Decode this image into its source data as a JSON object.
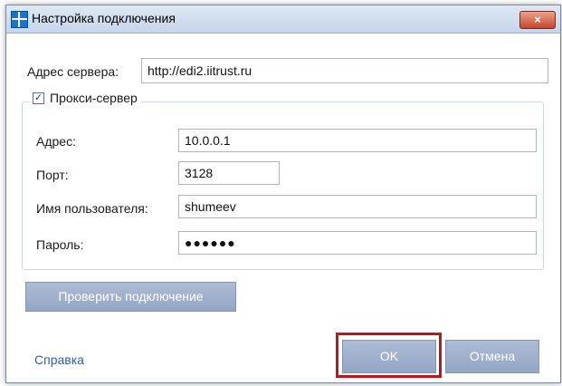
{
  "window": {
    "title": "Настройка подключения",
    "close_label": "×"
  },
  "server": {
    "label": "Адрес сервера:",
    "value": "http://edi2.iitrust.ru"
  },
  "proxy": {
    "checkbox_label": "Прокси-сервер",
    "checked": true,
    "address_label": "Адрес:",
    "address_value": "10.0.0.1",
    "port_label": "Порт:",
    "port_value": "3128",
    "username_label": "Имя пользователя:",
    "username_value": "shumeev",
    "password_label": "Пароль:",
    "password_value": "●●●●●●"
  },
  "actions": {
    "check_connection_label": "Проверить подключение",
    "help_label": "Справка",
    "ok_label": "OK",
    "cancel_label": "Отмена"
  },
  "colors": {
    "button_bg": "#9fb0cc",
    "link": "#2a61b5",
    "highlight": "#c0151a"
  }
}
